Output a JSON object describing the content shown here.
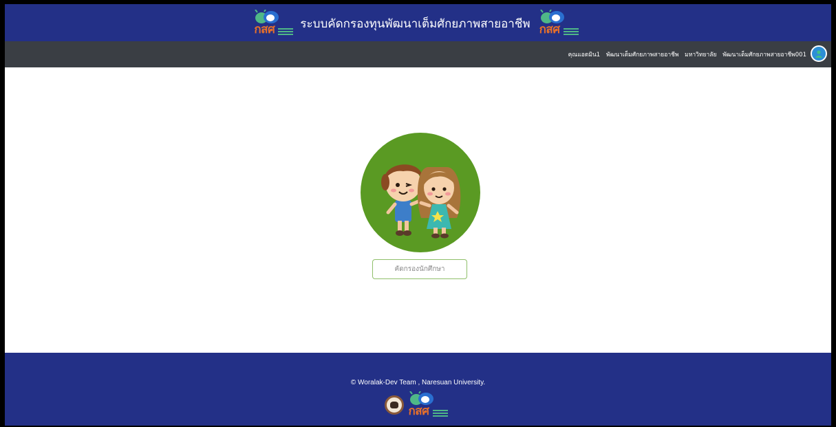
{
  "header": {
    "title": "ระบบคัดกรองทุนพัฒนาเต็มศักยภาพสายอาชีพ",
    "logo_text": "กสศ"
  },
  "userbar": {
    "name": "คุณแอดมิน1",
    "role": "พัฒนาเต็มศักยภาพสายอาชีพ",
    "institution": "มหาวิทยาลัย",
    "account": "พัฒนาเต็มศักยภาพสายอาชีพ001",
    "avatar_icon": "user-icon"
  },
  "main": {
    "illustration": "kids-illustration",
    "screen_button_label": "คัดกรองนักศึกษา"
  },
  "footer": {
    "copyright": "© Woralak-Dev Team , Naresuan University.",
    "logo_text": "กสศ"
  },
  "colors": {
    "brand_blue": "#233087",
    "userbar_gray": "#3a3e44",
    "avatar_blue": "#2c8fd6",
    "circle_green": "#5a9a23",
    "logo_orange": "#e8702a",
    "logo_green": "#4fb887"
  }
}
